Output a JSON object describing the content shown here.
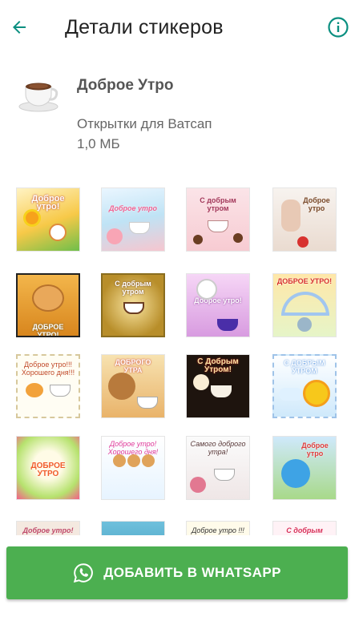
{
  "header": {
    "title": "Детали стикеров",
    "back_icon": "arrow-left-icon",
    "info_icon": "info-icon",
    "accent_color": "#0a8f80"
  },
  "pack": {
    "icon": "coffee-cup-icon",
    "name": "Доброе Утро",
    "publisher": "Открытки для Ватсап",
    "size": "1,0 МБ"
  },
  "stickers": [
    {
      "caption": "Доброе утро!"
    },
    {
      "caption": "Доброе утро"
    },
    {
      "caption": "С добрым утром"
    },
    {
      "caption": "Доброе утро"
    },
    {
      "caption": "ДОБРОЕ УТРО!"
    },
    {
      "caption": "С добрым утром"
    },
    {
      "caption": "Доброе утро!"
    },
    {
      "caption": "ДОБРОЕ УТРО!"
    },
    {
      "caption": "Доброе утро!!! Хорошего дня!!!"
    },
    {
      "caption": "ДОБРОГО УТРА"
    },
    {
      "caption": "С Добрым Утром!"
    },
    {
      "caption": "С ДОБРЫМ УТРОМ"
    },
    {
      "caption": "ДОБРОЕ УТРО"
    },
    {
      "caption": "Доброе утро! Хорошего дня!"
    },
    {
      "caption": "Самого доброго утра!"
    },
    {
      "caption": "Доброе утро"
    },
    {
      "caption": "Доброе утро!"
    },
    {
      "caption": ""
    },
    {
      "caption": "Доброе утро !!!"
    },
    {
      "caption": "С добрым утром!"
    }
  ],
  "add_button": {
    "label": "ДОБАВИТЬ В WHATSAPP",
    "icon": "whatsapp-icon",
    "color": "#4caf50"
  }
}
